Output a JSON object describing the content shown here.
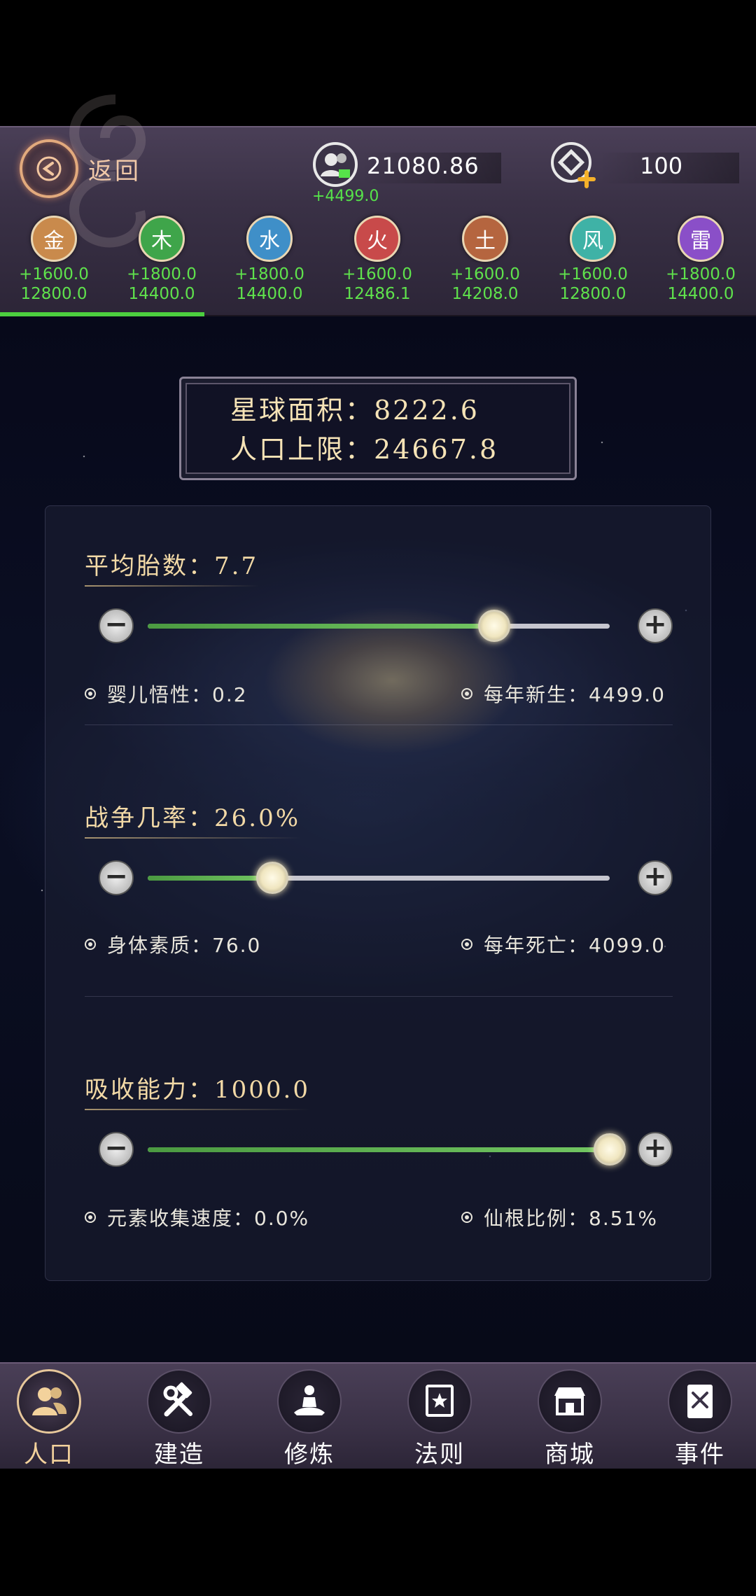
{
  "header": {
    "back_label": "返回",
    "population_value": "21080.86",
    "population_delta": "+4499.0",
    "gem_value": "100"
  },
  "elements": [
    {
      "char": "金",
      "plus": "+1600.0",
      "total": "12800.0",
      "color": "#c98a4c"
    },
    {
      "char": "木",
      "plus": "+1800.0",
      "total": "14400.0",
      "color": "#3fa54a"
    },
    {
      "char": "水",
      "plus": "+1800.0",
      "total": "14400.0",
      "color": "#3f8fc8"
    },
    {
      "char": "火",
      "plus": "+1600.0",
      "total": "12486.1",
      "color": "#c84a4a"
    },
    {
      "char": "土",
      "plus": "+1600.0",
      "total": "14208.0",
      "color": "#b5653f"
    },
    {
      "char": "风",
      "plus": "+1600.0",
      "total": "12800.0",
      "color": "#3fb2a6"
    },
    {
      "char": "雷",
      "plus": "+1800.0",
      "total": "14400.0",
      "color": "#8a4fc8"
    }
  ],
  "planet": {
    "area": "星球面积：8222.6",
    "pop_limit": "人口上限：24667.8"
  },
  "sections": {
    "fertility": {
      "title": "平均胎数：7.7",
      "level": 0.75,
      "stat_left": "婴儿悟性：0.2",
      "stat_right": "每年新生：4499.0"
    },
    "war": {
      "title": "战争几率：26.0%",
      "level": 0.27,
      "stat_left": "身体素质：76.0",
      "stat_right": "每年死亡：4099.0"
    },
    "absorb": {
      "title": "吸收能力：1000.0",
      "level": 1.0,
      "stat_left": "元素收集速度：0.0%",
      "stat_right": "仙根比例：8.51%"
    }
  },
  "nav": [
    {
      "label": "人口",
      "icon": "population-icon",
      "active": true
    },
    {
      "label": "建造",
      "icon": "build-icon",
      "active": false
    },
    {
      "label": "修炼",
      "icon": "meditate-icon",
      "active": false
    },
    {
      "label": "法则",
      "icon": "law-icon",
      "active": false
    },
    {
      "label": "商城",
      "icon": "shop-icon",
      "active": false
    },
    {
      "label": "事件",
      "icon": "event-icon",
      "active": false
    }
  ]
}
